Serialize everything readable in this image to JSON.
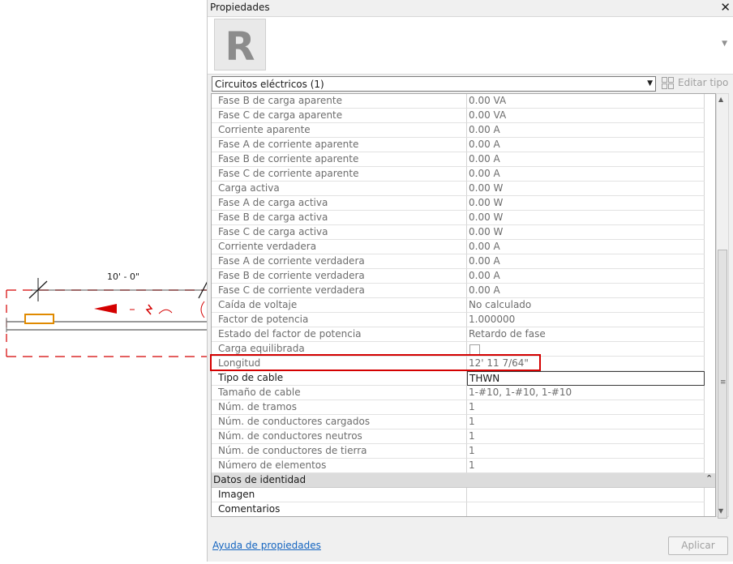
{
  "canvas": {
    "dimension_label": "10' - 0\""
  },
  "panel": {
    "title": "Propiedades",
    "logo_letter": "R",
    "selector": "Circuitos eléctricos (1)",
    "edit_type": "Editar tipo",
    "rows": [
      {
        "name": "Fase B de carga aparente",
        "value": "0.00 VA",
        "state": "ro"
      },
      {
        "name": "Fase C de carga aparente",
        "value": "0.00 VA",
        "state": "ro"
      },
      {
        "name": "Corriente aparente",
        "value": "0.00 A",
        "state": "ro"
      },
      {
        "name": "Fase A de corriente aparente",
        "value": "0.00 A",
        "state": "ro"
      },
      {
        "name": "Fase B de corriente aparente",
        "value": "0.00 A",
        "state": "ro"
      },
      {
        "name": "Fase C de corriente aparente",
        "value": "0.00 A",
        "state": "ro"
      },
      {
        "name": "Carga activa",
        "value": "0.00 W",
        "state": "ro"
      },
      {
        "name": "Fase A de carga activa",
        "value": "0.00 W",
        "state": "ro"
      },
      {
        "name": "Fase B de carga activa",
        "value": "0.00 W",
        "state": "ro"
      },
      {
        "name": "Fase C de carga activa",
        "value": "0.00 W",
        "state": "ro"
      },
      {
        "name": "Corriente verdadera",
        "value": "0.00 A",
        "state": "ro"
      },
      {
        "name": "Fase A de corriente verdadera",
        "value": "0.00 A",
        "state": "ro"
      },
      {
        "name": "Fase B de corriente verdadera",
        "value": "0.00 A",
        "state": "ro"
      },
      {
        "name": "Fase C de corriente verdadera",
        "value": "0.00 A",
        "state": "ro"
      },
      {
        "name": "Caída de voltaje",
        "value": "No calculado",
        "state": "ro"
      },
      {
        "name": "Factor de potencia",
        "value": "1.000000",
        "state": "ro"
      },
      {
        "name": "Estado del factor de potencia",
        "value": "Retardo de fase",
        "state": "ro"
      },
      {
        "name": "Carga equilibrada",
        "value": "",
        "state": "checkbox"
      },
      {
        "name": "Longitud",
        "value": "12'  11 7/64\"",
        "state": "ro"
      },
      {
        "name": "Tipo de cable",
        "value": "THWN",
        "state": "edit"
      },
      {
        "name": "Tamaño de cable",
        "value": "1-#10, 1-#10, 1-#10",
        "state": "ro"
      },
      {
        "name": "Núm. de tramos",
        "value": "1",
        "state": "ro"
      },
      {
        "name": "Núm. de conductores cargados",
        "value": "1",
        "state": "ro"
      },
      {
        "name": "Núm. de conductores neutros",
        "value": "1",
        "state": "ro"
      },
      {
        "name": "Núm. de conductores de tierra",
        "value": "1",
        "state": "ro"
      },
      {
        "name": "Número de elementos",
        "value": "1",
        "state": "ro"
      }
    ],
    "group_label": "Datos de identidad",
    "group_rows": [
      {
        "name": "Imagen",
        "value": ""
      },
      {
        "name": "Comentarios",
        "value": ""
      }
    ],
    "help_link": "Ayuda de propiedades",
    "apply_button": "Aplicar"
  }
}
